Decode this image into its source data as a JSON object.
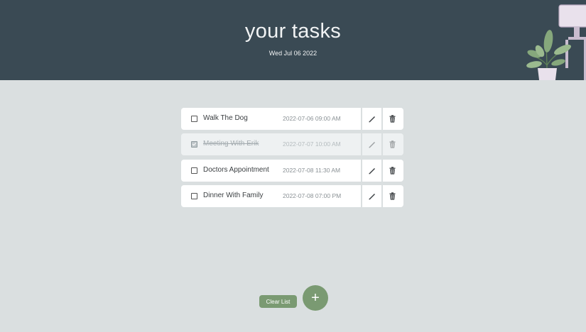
{
  "header": {
    "title": "your tasks",
    "date": "Wed Jul 06 2022"
  },
  "tasks": [
    {
      "name": "Walk The Dog",
      "datetime": "2022-07-06 09:00 AM",
      "completed": false
    },
    {
      "name": "Meeting With Erik",
      "datetime": "2022-07-07 10:00 AM",
      "completed": true
    },
    {
      "name": "Doctors Appointment",
      "datetime": "2022-07-08 11:30 AM",
      "completed": false
    },
    {
      "name": "Dinner With Family",
      "datetime": "2022-07-08 07:00 PM",
      "completed": false
    }
  ],
  "actions": {
    "clear_label": "Clear List",
    "add_label": "+"
  },
  "icons": {
    "edit": "pencil-icon",
    "delete": "trash-icon"
  },
  "colors": {
    "header_bg": "#3a4a54",
    "page_bg": "#dadfe0",
    "accent": "#7a9a72"
  }
}
